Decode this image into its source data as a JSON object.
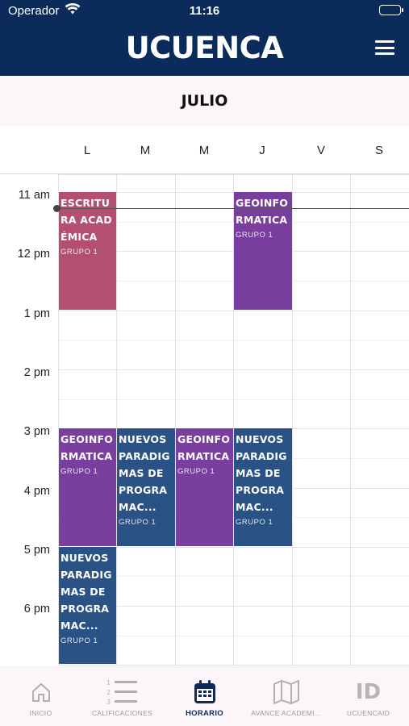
{
  "status_bar": {
    "carrier": "Operador",
    "time": "11:16"
  },
  "header": {
    "brand": "UCUENCA",
    "menu_icon": "hamburger-menu-icon"
  },
  "calendar": {
    "month": "JULIO",
    "weekdays": [
      "L",
      "M",
      "M",
      "J",
      "V",
      "S"
    ],
    "hours": [
      "11 am",
      "12 pm",
      "1 pm",
      "2 pm",
      "3 pm",
      "4 pm",
      "5 pm",
      "6 pm"
    ],
    "events": [
      {
        "title": "ESCRITURA ACADÉMICA",
        "group": "GRUPO 1",
        "color": "#b44e72",
        "day": 0,
        "start": 11,
        "end": 13
      },
      {
        "title": "GEOINFORMATICA",
        "group": "GRUPO 1",
        "color": "#7a3f9e",
        "day": 3,
        "start": 11,
        "end": 13
      },
      {
        "title": "GEOINFORMATICA",
        "group": "GRUPO 1",
        "color": "#7a3f9e",
        "day": 0,
        "start": 15,
        "end": 17
      },
      {
        "title": "NUEVOS PARADIGMAS DE PROGRAMAC...",
        "group": "GRUPO 1",
        "color": "#2a5285",
        "day": 1,
        "start": 15,
        "end": 17
      },
      {
        "title": "GEOINFORMATICA",
        "group": "GRUPO 1",
        "color": "#7a3f9e",
        "day": 2,
        "start": 15,
        "end": 17
      },
      {
        "title": "NUEVOS PARADIGMAS DE PROGRAMAC...",
        "group": "GRUPO 1",
        "color": "#2a5285",
        "day": 3,
        "start": 15,
        "end": 17
      },
      {
        "title": "NUEVOS PARADIGMAS DE PROGRAMAC...",
        "group": "GRUPO 1",
        "color": "#2a5285",
        "day": 0,
        "start": 17,
        "end": 19
      }
    ]
  },
  "tabs": [
    {
      "label": "INICIO",
      "icon": "home-icon",
      "active": false
    },
    {
      "label": "CALIFICACIONES",
      "icon": "numbered-list-icon",
      "active": false
    },
    {
      "label": "HORARIO",
      "icon": "calendar-icon",
      "active": true
    },
    {
      "label": "AVANCE ACADEMI...",
      "icon": "map-icon",
      "active": false
    },
    {
      "label": "UCUENCAID",
      "icon": "id-icon",
      "active": false
    }
  ],
  "colors": {
    "header_bg": "#0b2c5b",
    "accent": "#0b2c5b"
  }
}
